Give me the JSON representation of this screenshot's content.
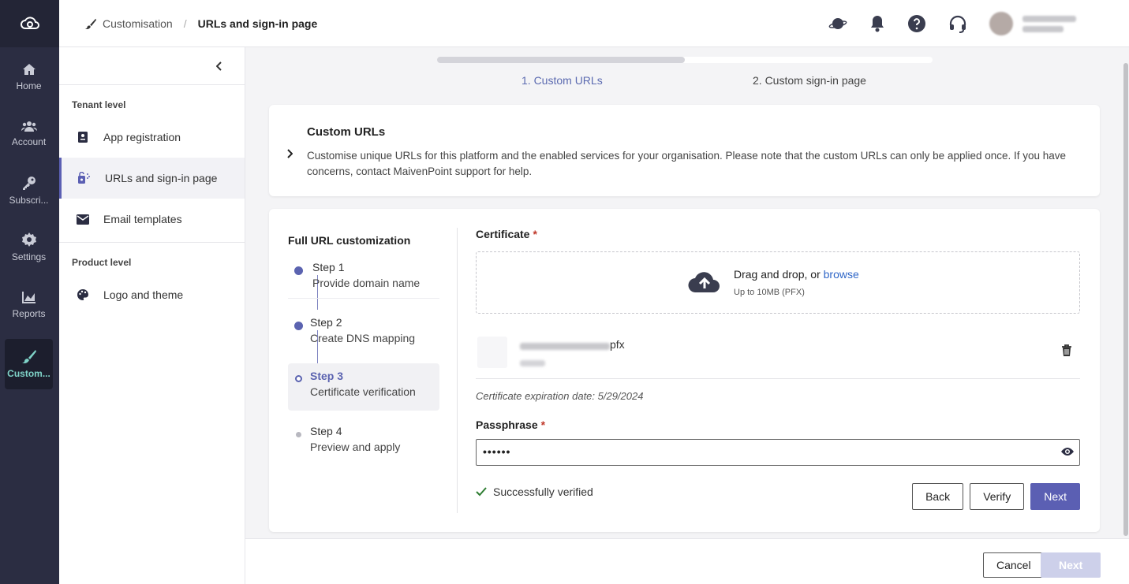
{
  "rail": {
    "items": [
      {
        "label": "Home",
        "icon": "home-icon"
      },
      {
        "label": "Account",
        "icon": "users-icon"
      },
      {
        "label": "Subscri...",
        "icon": "key-icon"
      },
      {
        "label": "Settings",
        "icon": "gear-icon"
      },
      {
        "label": "Reports",
        "icon": "chart-icon"
      },
      {
        "label": "Custom...",
        "icon": "brush-icon"
      }
    ],
    "active_color": "#7fd3c8",
    "bg_color": "#2b2d42"
  },
  "breadcrumb": {
    "parent": "Customisation",
    "current": "URLs and sign-in page"
  },
  "subnav": {
    "tenant_label": "Tenant level",
    "tenant_items": [
      {
        "label": "App registration"
      },
      {
        "label": "URLs and sign-in page"
      },
      {
        "label": "Email templates"
      }
    ],
    "product_label": "Product level",
    "product_items": [
      {
        "label": "Logo and theme"
      }
    ]
  },
  "wizard": {
    "progress": 0.5,
    "steps": [
      "1. Custom URLs",
      "2. Custom sign-in page"
    ]
  },
  "intro": {
    "title": "Custom URLs",
    "description": "Customise unique URLs for this platform and the enabled services for your organisation. Please note that the custom URLs can only be applied once. If you have concerns, contact MaivenPoint support for help."
  },
  "full": {
    "title": "Full URL customization",
    "steps": [
      {
        "title": "Step 1",
        "desc": "Provide domain name",
        "state": "done"
      },
      {
        "title": "Step 2",
        "desc": "Create DNS mapping",
        "state": "done"
      },
      {
        "title": "Step 3",
        "desc": "Certificate verification",
        "state": "current"
      },
      {
        "title": "Step 4",
        "desc": "Preview and apply",
        "state": "todo"
      }
    ]
  },
  "cert": {
    "label": "Certificate",
    "required_mark": "*",
    "drop_text": "Drag and drop, or",
    "browse_link": "browse",
    "drop_hint": "Up to 10MB (PFX)",
    "file_ext": "pfx",
    "expiry": "Certificate expiration date: 5/29/2024"
  },
  "pass": {
    "label": "Passphrase",
    "required_mark": "*",
    "value": "••••••"
  },
  "status": {
    "text": "Successfully verified",
    "color": "#2e7d32"
  },
  "buttons": {
    "back": "Back",
    "verify": "Verify",
    "next": "Next"
  },
  "footer": {
    "cancel": "Cancel",
    "next": "Next"
  },
  "colors": {
    "accent": "#5b5fb3",
    "link": "#2f66c7",
    "required": "#c0392b"
  }
}
